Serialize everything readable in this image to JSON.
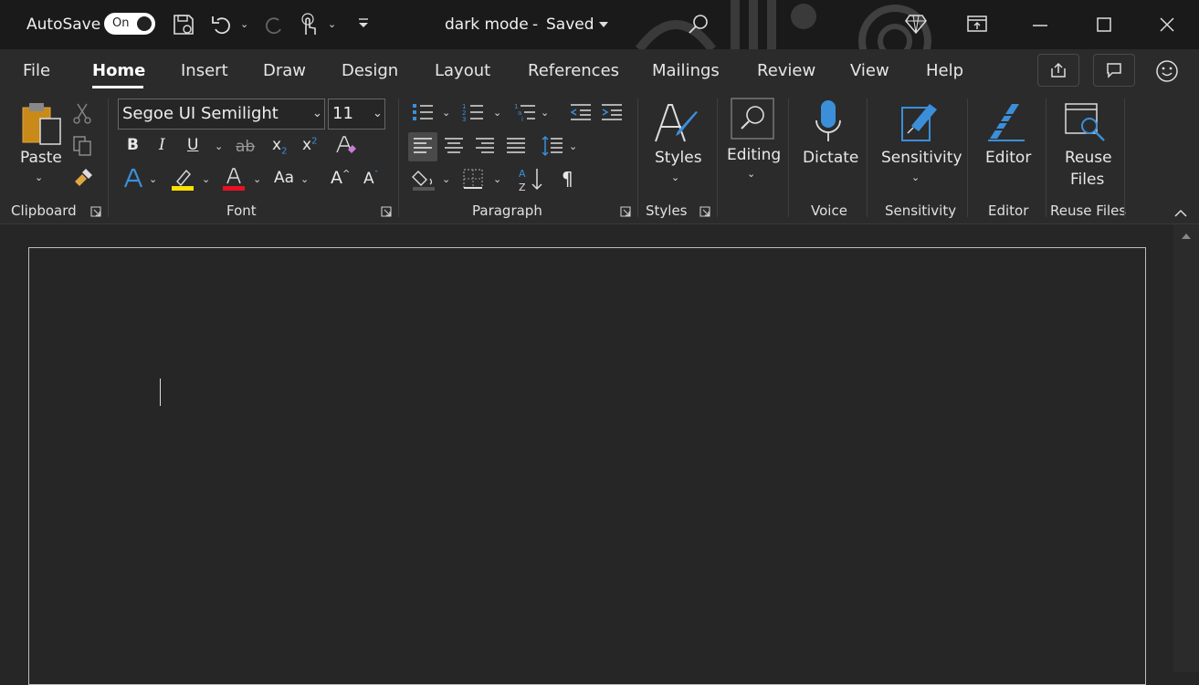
{
  "titlebar": {
    "autosave_label": "AutoSave",
    "autosave_state": "On",
    "doc_title": "dark mode",
    "dash": "-",
    "save_status": "Saved"
  },
  "menu": {
    "tabs": [
      "File",
      "Home",
      "Insert",
      "Draw",
      "Design",
      "Layout",
      "References",
      "Mailings",
      "Review",
      "View",
      "Help"
    ]
  },
  "ribbon": {
    "clipboard": {
      "paste_label": "Paste",
      "group_label": "Clipboard"
    },
    "font": {
      "font_name": "Segoe UI Semilight",
      "font_size": "11",
      "group_label": "Font"
    },
    "paragraph": {
      "group_label": "Paragraph"
    },
    "styles": {
      "label": "Styles",
      "group_label": "Styles"
    },
    "editing": {
      "label": "Editing"
    },
    "voice": {
      "label": "Dictate",
      "group_label": "Voice"
    },
    "sensitivity": {
      "label": "Sensitivity",
      "group_label": "Sensitivity"
    },
    "editor": {
      "label": "Editor",
      "group_label": "Editor"
    },
    "reuse": {
      "label_line1": "Reuse",
      "label_line2": "Files",
      "group_label": "Reuse Files"
    }
  },
  "colors": {
    "accent": "#3b8fd9",
    "highlight": "#ffe000",
    "font_color": "#e81123"
  }
}
